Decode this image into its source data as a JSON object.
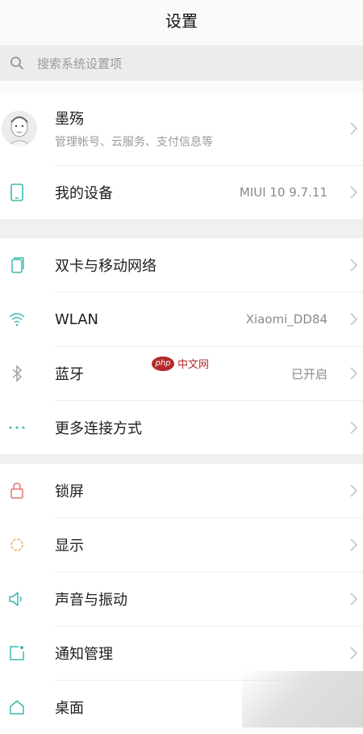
{
  "header": {
    "title": "设置"
  },
  "search": {
    "placeholder": "搜索系统设置项"
  },
  "account": {
    "name": "墨殇",
    "subtitle": "管理帐号、云服务、支付信息等"
  },
  "device": {
    "label": "我的设备",
    "value": "MIUI 10 9.7.11"
  },
  "network_group": [
    {
      "key": "dual-sim",
      "icon": "sim-card-icon",
      "label": "双卡与移动网络",
      "value": ""
    },
    {
      "key": "wlan",
      "icon": "wifi-icon",
      "label": "WLAN",
      "value": "Xiaomi_DD84"
    },
    {
      "key": "bluetooth",
      "icon": "bluetooth-icon",
      "label": "蓝牙",
      "value": "已开启"
    },
    {
      "key": "more-connections",
      "icon": "more-dots-icon",
      "label": "更多连接方式",
      "value": ""
    }
  ],
  "display_group": [
    {
      "key": "lock-screen",
      "icon": "lock-icon",
      "label": "锁屏"
    },
    {
      "key": "display",
      "icon": "display-icon",
      "label": "显示"
    },
    {
      "key": "sound",
      "icon": "speaker-icon",
      "label": "声音与振动"
    },
    {
      "key": "notifications",
      "icon": "notification-icon",
      "label": "通知管理"
    },
    {
      "key": "home-screen",
      "icon": "home-icon",
      "label": "桌面"
    }
  ],
  "watermark": {
    "logo": "php",
    "text": "中文网"
  },
  "colors": {
    "accent_teal": "#3fb8af",
    "lock_red": "#e57373",
    "display_orange": "#f0b36d",
    "watermark_red": "#b32b2b"
  }
}
